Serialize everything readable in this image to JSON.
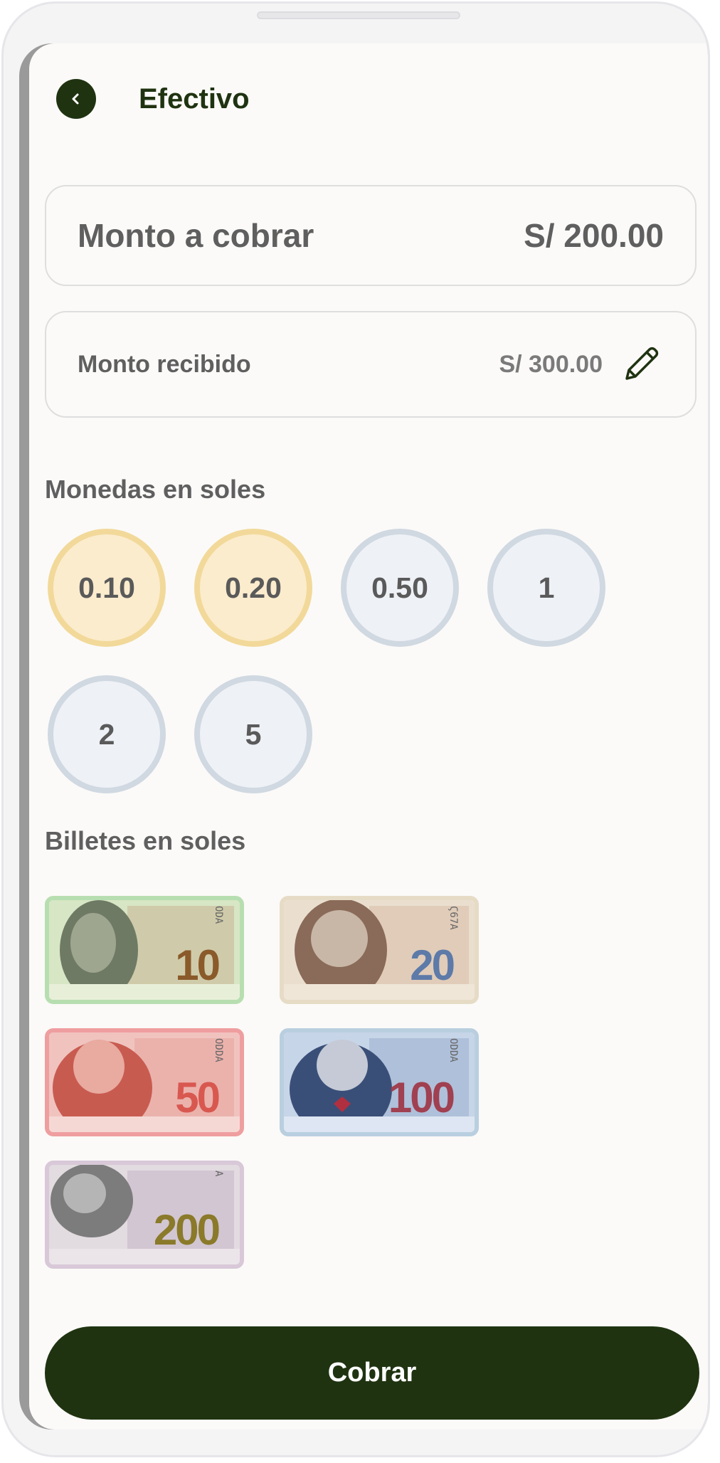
{
  "header": {
    "title": "Efectivo",
    "back_icon": "chevron-left-icon"
  },
  "amount_due": {
    "label": "Monto a cobrar",
    "value": "S/ 200.00"
  },
  "amount_received": {
    "label": "Monto recibido",
    "value": "S/ 300.00",
    "edit_icon": "pencil-icon"
  },
  "coins": {
    "title": "Monedas en soles",
    "items": [
      {
        "label": "0.10",
        "style": "gold"
      },
      {
        "label": "0.20",
        "style": "gold"
      },
      {
        "label": "0.50",
        "style": "silver"
      },
      {
        "label": "1",
        "style": "silver"
      },
      {
        "label": "2",
        "style": "silver"
      },
      {
        "label": "5",
        "style": "silver"
      }
    ]
  },
  "bills": {
    "title": "Billetes en soles",
    "items": [
      {
        "label": "10",
        "frame_color": "#b7deb0",
        "tint": "#d9e8c8",
        "ink": "#8a5a2a"
      },
      {
        "label": "20",
        "frame_color": "#e6dcc6",
        "tint": "#eadfcf",
        "ink": "#5d7aa8"
      },
      {
        "label": "50",
        "frame_color": "#ef9ea0",
        "tint": "#f0c3bf",
        "ink": "#d8584f"
      },
      {
        "label": "100",
        "frame_color": "#b9cfe0",
        "tint": "#c7d5e8",
        "ink": "#a04050"
      },
      {
        "label": "200",
        "frame_color": "#d8c8d8",
        "tint": "#e2dbe0",
        "ink": "#8a7a2a"
      }
    ]
  },
  "action": {
    "label": "Cobrar"
  },
  "colors": {
    "primary": "#1f3311",
    "coin_gold": "#f2d99a",
    "coin_silver": "#d0d8e1"
  }
}
